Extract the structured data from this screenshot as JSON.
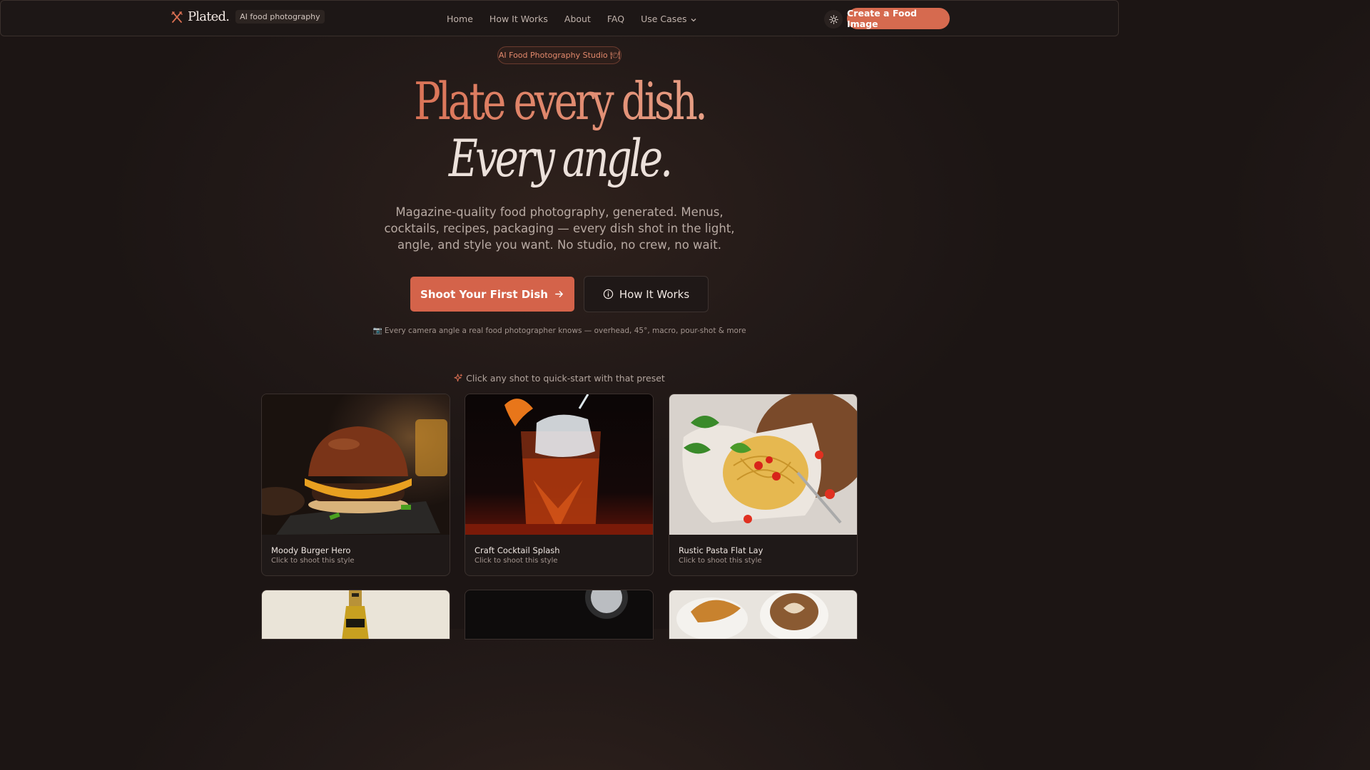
{
  "nav": {
    "brand": "Plated.",
    "badge": "AI food photography",
    "links": [
      "Home",
      "How It Works",
      "About",
      "FAQ",
      "Use Cases"
    ],
    "cta": "Create a Food Image"
  },
  "hero": {
    "pill": "AI Food Photography Studio 🍽",
    "title_line1": "Plate every dish.",
    "title_line2": "Every angle.",
    "subtitle": "Magazine-quality food photography, generated. Menus, cocktails, recipes, packaging — every dish shot in the light, angle, and style you want. No studio, no crew, no wait.",
    "primary_button": "Shoot Your First Dish",
    "secondary_button": "How It Works",
    "angles_note": "📷 Every camera angle a real food photographer knows — overhead, 45°, macro, pour-shot & more"
  },
  "presets": {
    "hint": "Click any shot to quick-start with that preset",
    "cards": [
      {
        "title": "Moody Burger Hero",
        "sub": "Click to shoot this style"
      },
      {
        "title": "Craft Cocktail Splash",
        "sub": "Click to shoot this style"
      },
      {
        "title": "Rustic Pasta Flat Lay",
        "sub": "Click to shoot this style"
      }
    ]
  },
  "colors": {
    "accent": "#d4634a",
    "background": "#1c1514"
  }
}
